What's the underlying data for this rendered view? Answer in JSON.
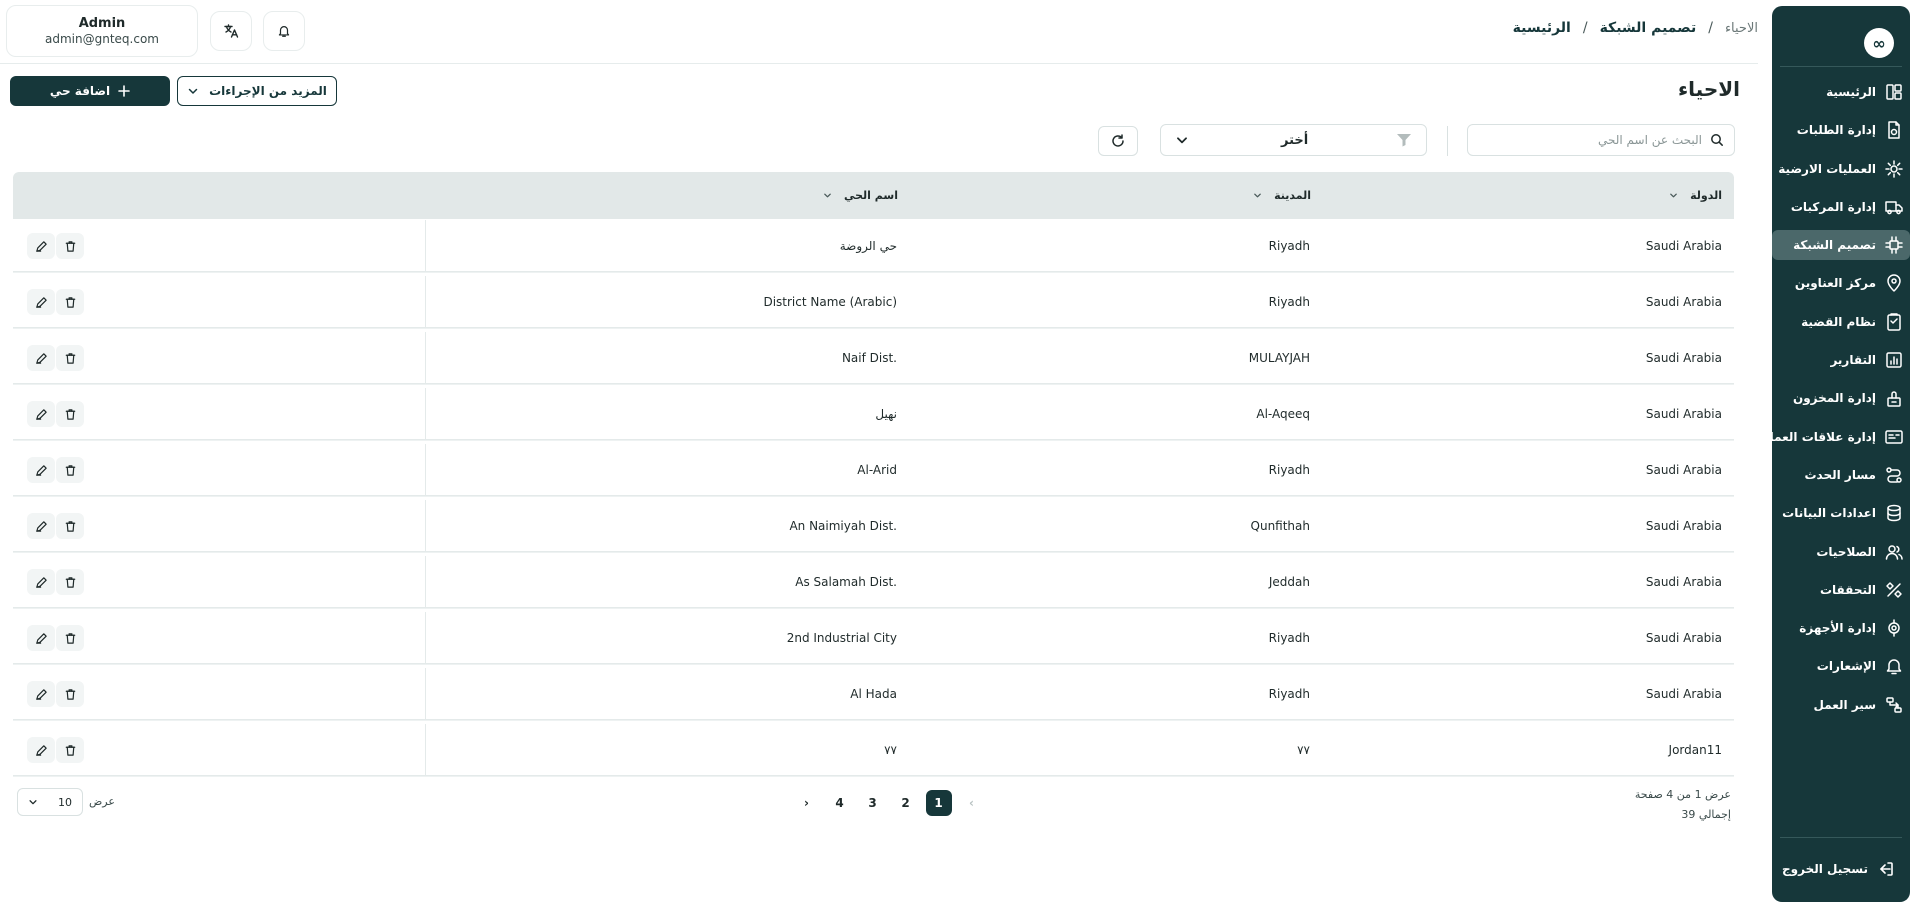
{
  "sidebar": {
    "logo": "∞",
    "items": [
      {
        "label": "الرئيسية",
        "icon": "dashboard-icon",
        "active": false
      },
      {
        "label": "إدارة الطلبات",
        "icon": "orders-icon",
        "active": false
      },
      {
        "label": "العمليات الارضية",
        "icon": "ground-ops-icon",
        "active": false
      },
      {
        "label": "إدارة المركبات",
        "icon": "truck-icon",
        "active": false
      },
      {
        "label": "تصميم الشبكة",
        "icon": "network-icon",
        "active": true
      },
      {
        "label": "مركز العناوين",
        "icon": "map-pin-icon",
        "active": false
      },
      {
        "label": "نظام القضية",
        "icon": "case-icon",
        "active": false
      },
      {
        "label": "التقارير",
        "icon": "reports-icon",
        "active": false
      },
      {
        "label": "إدارة المخزون",
        "icon": "inventory-icon",
        "active": false
      },
      {
        "label": "إدارة علاقات العملاء",
        "icon": "crm-icon",
        "active": false
      },
      {
        "label": "مسار الحدث",
        "icon": "route-icon",
        "active": false
      },
      {
        "label": "اعدادات البيانات",
        "icon": "database-icon",
        "active": false
      },
      {
        "label": "الصلاحيات",
        "icon": "users-icon",
        "active": false
      },
      {
        "label": "التحققات",
        "icon": "verify-icon",
        "active": false
      },
      {
        "label": "إدارة الأجهزة",
        "icon": "devices-icon",
        "active": false
      },
      {
        "label": "الإشعارات",
        "icon": "bell-icon",
        "active": false
      },
      {
        "label": "سير العمل",
        "icon": "workflow-icon",
        "active": false
      }
    ],
    "logout_label": "تسجيل الخروج"
  },
  "header": {
    "user_name": "Admin",
    "user_email": "admin@gnteq.com",
    "breadcrumb": {
      "home": "الرئيسية",
      "section": "تصميم الشبكة",
      "current": "الاحياء",
      "separator": "/"
    }
  },
  "page": {
    "title": "الاحياء",
    "add_button": "اضافة حي",
    "more_actions": "المزيد من الإجراءات"
  },
  "filters": {
    "search_placeholder": "البحث عن اسم الحي",
    "select_value": "أختر"
  },
  "table": {
    "columns": {
      "country": "الدولة",
      "city": "المدينة",
      "district": "اسم الحي"
    },
    "rows": [
      {
        "country": "Saudi Arabia",
        "city": "Riyadh",
        "district": "حي الروضة"
      },
      {
        "country": "Saudi Arabia",
        "city": "Riyadh",
        "district": "District Name (Arabic)"
      },
      {
        "country": "Saudi Arabia",
        "city": "MULAYJAH",
        "district": "Naif Dist."
      },
      {
        "country": "Saudi Arabia",
        "city": "Al-Aqeeq",
        "district": "نهيل"
      },
      {
        "country": "Saudi Arabia",
        "city": "Riyadh",
        "district": "Al-Arid"
      },
      {
        "country": "Saudi Arabia",
        "city": "Qunfithah",
        "district": "An Naimiyah Dist."
      },
      {
        "country": "Saudi Arabia",
        "city": "Jeddah",
        "district": "As Salamah Dist."
      },
      {
        "country": "Saudi Arabia",
        "city": "Riyadh",
        "district": "2nd Industrial City"
      },
      {
        "country": "Saudi Arabia",
        "city": "Riyadh",
        "district": "Al Hada"
      },
      {
        "country": "Jordan11",
        "city": "٧٧",
        "district": "٧٧"
      }
    ]
  },
  "pagination": {
    "info_pages": "عرض 1 من 4 صفحة",
    "info_total": "إجمالي 39",
    "prev": "‹",
    "next": "›",
    "pages": [
      "1",
      "2",
      "3",
      "4"
    ],
    "current": "1",
    "per_page_label": "عرض",
    "per_page_value": "10"
  },
  "colors": {
    "primary": "#16373a",
    "sidebar_active": "#4b686a",
    "table_header": "#e2e8e8"
  }
}
